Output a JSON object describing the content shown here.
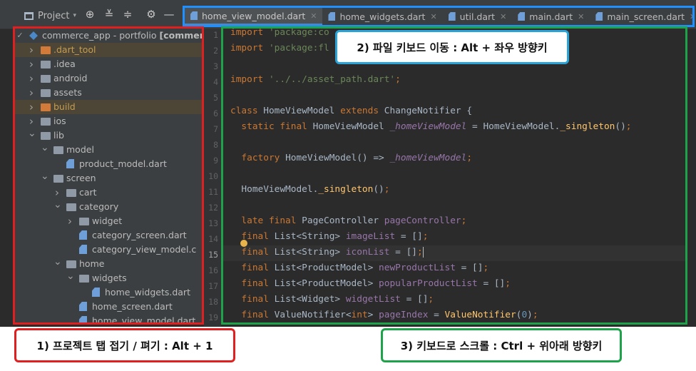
{
  "toolbar": {
    "project_label": "Project",
    "icons": [
      "globe-target-icon",
      "collapse-all-icon",
      "expand-all-icon",
      "gear-icon",
      "minimize-icon"
    ]
  },
  "tabs": [
    {
      "label": "home_view_model.dart",
      "active": true
    },
    {
      "label": "home_widgets.dart"
    },
    {
      "label": "util.dart"
    },
    {
      "label": "main.dart"
    },
    {
      "label": "main_screen.dart"
    },
    {
      "label": "categ"
    }
  ],
  "tree": {
    "root": {
      "name": "commerce_app",
      "suffix": " - portfolio ",
      "bold": "[commer"
    },
    "items": [
      {
        "label": ".dart_tool",
        "kind": "folder-orange",
        "arrow": "right",
        "excluded": true
      },
      {
        "label": ".idea",
        "kind": "folder",
        "arrow": "right"
      },
      {
        "label": "android",
        "kind": "folder",
        "arrow": "right"
      },
      {
        "label": "assets",
        "kind": "folder",
        "arrow": "right"
      },
      {
        "label": "build",
        "kind": "folder-orange",
        "arrow": "right",
        "excluded": true
      },
      {
        "label": "ios",
        "kind": "folder",
        "arrow": "right"
      },
      {
        "label": "lib",
        "kind": "folder",
        "arrow": "down"
      },
      {
        "label": "model",
        "kind": "folder",
        "arrow": "down"
      },
      {
        "label": "product_model.dart",
        "kind": "dart"
      },
      {
        "label": "screen",
        "kind": "folder",
        "arrow": "down"
      },
      {
        "label": "cart",
        "kind": "folder",
        "arrow": "right"
      },
      {
        "label": "category",
        "kind": "folder",
        "arrow": "down"
      },
      {
        "label": "widget",
        "kind": "folder",
        "arrow": "right"
      },
      {
        "label": "category_screen.dart",
        "kind": "dart"
      },
      {
        "label": "category_view_model.c",
        "kind": "dart"
      },
      {
        "label": "home",
        "kind": "folder",
        "arrow": "down"
      },
      {
        "label": "widgets",
        "kind": "folder",
        "arrow": "down"
      },
      {
        "label": "home_widgets.dart",
        "kind": "dart"
      },
      {
        "label": "home_screen.dart",
        "kind": "dart"
      },
      {
        "label": "home_view_model.dart",
        "kind": "dart"
      }
    ]
  },
  "line_numbers": [
    "1",
    "2",
    "3",
    "4",
    "5",
    "6",
    "7",
    "8",
    "9",
    "10",
    "11",
    "12",
    "13",
    "14",
    "15",
    "16",
    "17",
    "18",
    "19"
  ],
  "callouts": {
    "c1": "1) 프로젝트 탭 접기 / 펴기 : Alt + 1",
    "c2": "2) 파일 키보드 이동 : Alt + 좌우 방향키",
    "c3": "3) 키보드로 스크롤 : Ctrl + 위아래 방향키"
  },
  "colors": {
    "callout1_border": "#e02020",
    "callout2_border": "#2aa3d8",
    "callout3_border": "#1fa34a",
    "tabs_highlight": "#1e90ff"
  }
}
